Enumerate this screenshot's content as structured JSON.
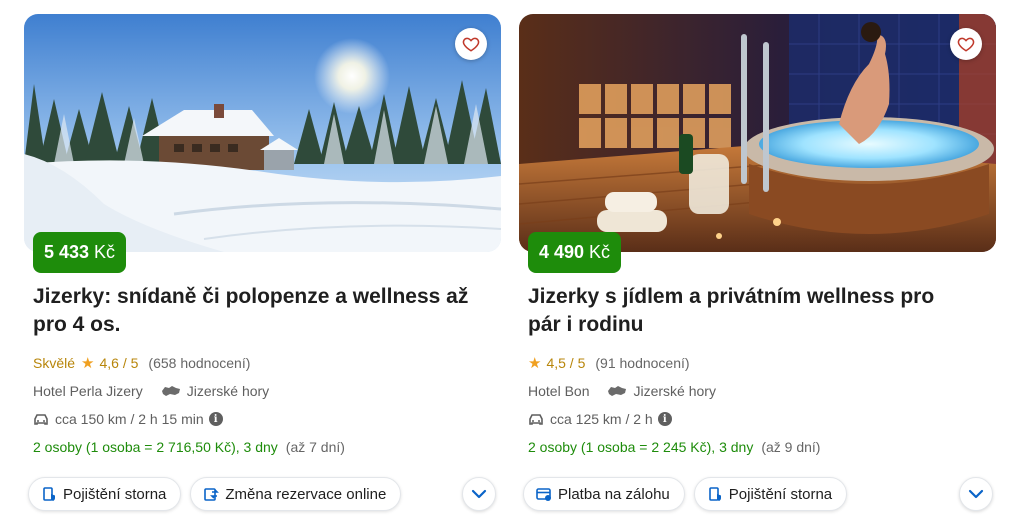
{
  "colors": {
    "price_bg": "#1e8c0b",
    "accent_blue": "#0a64c8",
    "rating_gold": "#b8860b",
    "star": "#f0a020",
    "stay_green": "#1e8c0b"
  },
  "cards": [
    {
      "photo_icon": "winter-hotel-photo",
      "price_value": "5 433",
      "price_currency": "Kč",
      "title": "Jizerky: snídaně či polopenze a wellness až pro 4 os.",
      "rating_verdict": "Skvělé",
      "rating_score": "4,6 / 5",
      "rating_count": "(658 hodnocení)",
      "hotel_name": "Hotel Perla Jizery",
      "region": "Jizerské hory",
      "travel": "cca 150 km / 2 h 15 min",
      "stay_main": "2 osoby (1 osoba = 2 716,50 Kč), 3 dny",
      "stay_extra": "(až 7 dní)",
      "chips": [
        {
          "label": "Pojištění storna",
          "icon": "insurance-icon"
        },
        {
          "label": "Změna rezervace online",
          "icon": "change-reservation-icon"
        }
      ]
    },
    {
      "photo_icon": "wellness-whirlpool-photo",
      "price_value": "4 490",
      "price_currency": "Kč",
      "title": "Jizerky s jídlem a privátním wellness pro pár i rodinu",
      "rating_verdict": "",
      "rating_score": "4,5 / 5",
      "rating_count": "(91 hodnocení)",
      "hotel_name": "Hotel Bon",
      "region": "Jizerské hory",
      "travel": "cca 125 km / 2 h",
      "stay_main": "2 osoby (1 osoba = 2 245 Kč), 3 dny",
      "stay_extra": "(až 9 dní)",
      "chips": [
        {
          "label": "Platba na zálohu",
          "icon": "deposit-payment-icon"
        },
        {
          "label": "Pojištění storna",
          "icon": "insurance-icon"
        }
      ]
    }
  ]
}
